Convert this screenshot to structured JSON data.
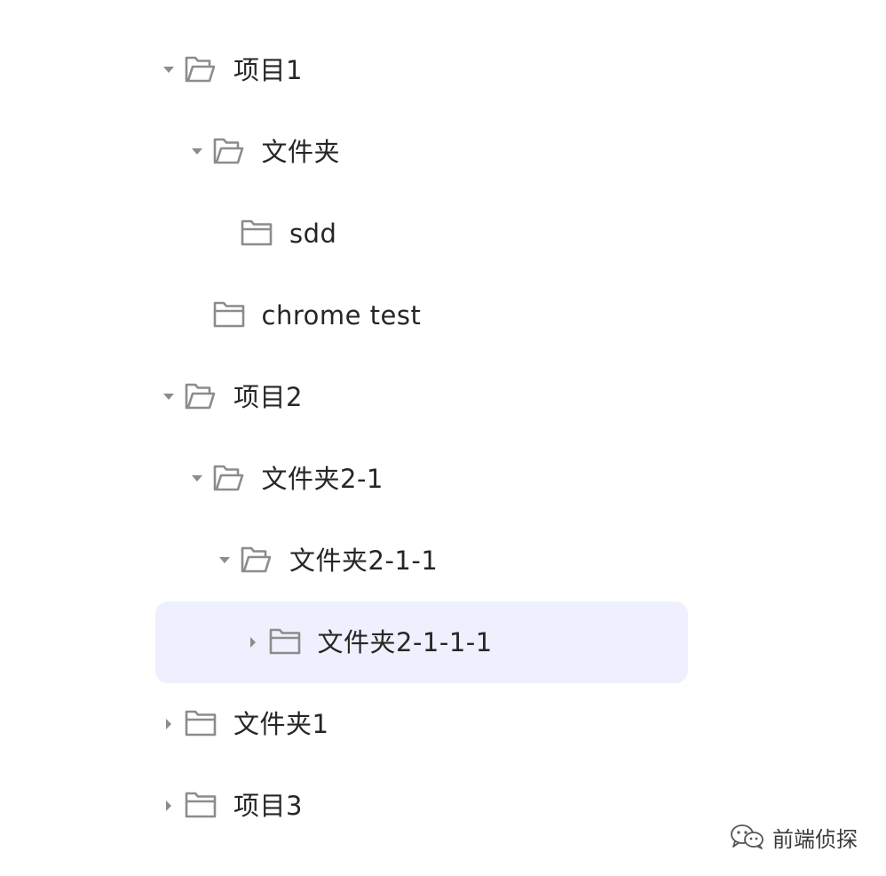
{
  "tree": {
    "nodes": [
      {
        "label": "项目1",
        "depth": 0,
        "expanded": true,
        "has_children": true,
        "selected": false
      },
      {
        "label": "文件夹",
        "depth": 1,
        "expanded": true,
        "has_children": true,
        "selected": false
      },
      {
        "label": "sdd",
        "depth": 2,
        "expanded": false,
        "has_children": false,
        "selected": false
      },
      {
        "label": "chrome test",
        "depth": 1,
        "expanded": false,
        "has_children": false,
        "selected": false
      },
      {
        "label": "项目2",
        "depth": 0,
        "expanded": true,
        "has_children": true,
        "selected": false
      },
      {
        "label": "文件夹2-1",
        "depth": 1,
        "expanded": true,
        "has_children": true,
        "selected": false
      },
      {
        "label": "文件夹2-1-1",
        "depth": 2,
        "expanded": true,
        "has_children": true,
        "selected": false
      },
      {
        "label": "文件夹2-1-1-1",
        "depth": 3,
        "expanded": false,
        "has_children": true,
        "selected": true
      },
      {
        "label": "文件夹1",
        "depth": 0,
        "expanded": false,
        "has_children": true,
        "selected": false
      },
      {
        "label": "项目3",
        "depth": 0,
        "expanded": false,
        "has_children": true,
        "selected": false
      }
    ],
    "icons": {
      "expanded": "caret-down-icon",
      "collapsed": "caret-right-icon",
      "folder_open": "folder-open-icon",
      "folder_closed": "folder-icon"
    },
    "colors": {
      "text": "#262626",
      "icon": "#8c8c8c",
      "selected_bg": "#eef1fd"
    }
  },
  "watermark": {
    "icon": "wechat-icon",
    "text": "前端侦探"
  }
}
